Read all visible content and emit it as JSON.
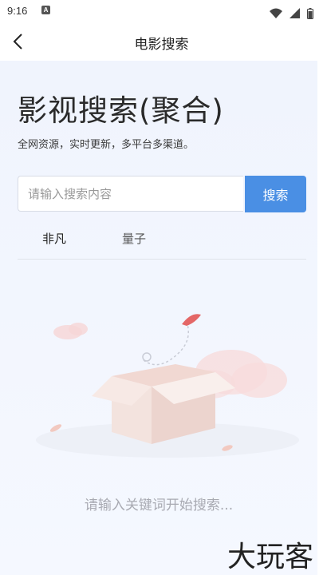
{
  "status_bar": {
    "time": "9:16",
    "app_icon_letter": "A"
  },
  "app_bar": {
    "title": "电影搜索",
    "back_icon": "chevron-left-icon"
  },
  "hero": {
    "title": "影视搜索(聚合)",
    "subtitle": "全网资源，实时更新，多平台多渠道。"
  },
  "search": {
    "placeholder": "请输入搜索内容",
    "value": "",
    "button_label": "搜索",
    "button_color": "#4a8fe4"
  },
  "tabs": [
    {
      "label": "非凡",
      "active": true
    },
    {
      "label": "量子",
      "active": false
    }
  ],
  "empty_state": {
    "hint": "请输入关键词开始搜索...",
    "icon": "empty-box-illustration"
  },
  "watermark": "大玩客"
}
